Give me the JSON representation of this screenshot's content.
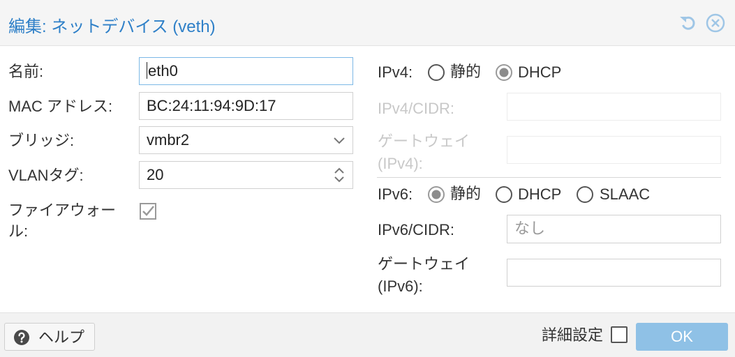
{
  "dialog": {
    "title": "編集: ネットデバイス (veth)"
  },
  "left": {
    "name": {
      "label": "名前:",
      "value": "eth0"
    },
    "mac": {
      "label": "MAC アドレス:",
      "value": "BC:24:11:94:9D:17"
    },
    "bridge": {
      "label": "ブリッジ:",
      "value": "vmbr2"
    },
    "vlan": {
      "label": "VLANタグ:",
      "value": "20"
    },
    "firewall": {
      "label_line1": "ファイアウォー",
      "label_line2": "ル:",
      "checked": true
    }
  },
  "right": {
    "ipv4": {
      "label": "IPv4:",
      "options": [
        "静的",
        "DHCP"
      ],
      "selected": "DHCP",
      "cidr_label": "IPv4/CIDR:",
      "cidr_value": "",
      "gateway_label_line1": "ゲートウェイ",
      "gateway_label_line2": "(IPv4):",
      "gateway_value": ""
    },
    "ipv6": {
      "label": "IPv6:",
      "options": [
        "静的",
        "DHCP",
        "SLAAC"
      ],
      "selected": "静的",
      "cidr_label": "IPv6/CIDR:",
      "cidr_placeholder": "なし",
      "gateway_label_line1": "ゲートウェイ",
      "gateway_label_line2": "(IPv6):",
      "gateway_value": ""
    }
  },
  "footer": {
    "help_label": "ヘルプ",
    "advanced_label": "詳細設定",
    "advanced_checked": false,
    "ok_label": "OK"
  },
  "icons": {
    "reset": "reset-icon",
    "close": "close-icon",
    "help": "help-icon",
    "dropdown": "chevron-down-icon",
    "spinner": "spinner-icon",
    "checkbox": "checkbox-checked-icon"
  },
  "colors": {
    "title": "#2f80c8",
    "ok_button": "#8fc1e6",
    "focus_border": "#7cb8e6"
  }
}
